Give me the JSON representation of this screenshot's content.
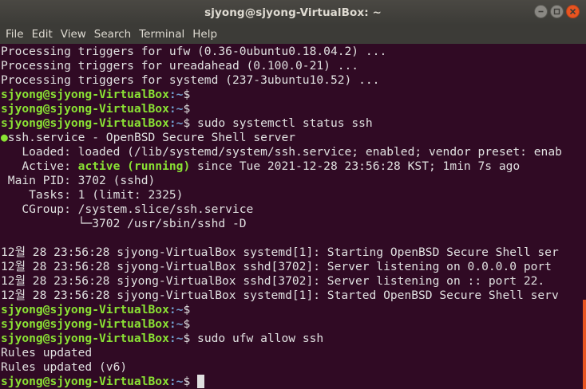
{
  "window": {
    "title": "sjyong@sjyong-VirtualBox: ~"
  },
  "menu": {
    "items": [
      "File",
      "Edit",
      "View",
      "Search",
      "Terminal",
      "Help"
    ]
  },
  "terminal": {
    "prompt_user": "sjyong@sjyong-VirtualBox",
    "prompt_path": ":~",
    "prompt_suffix": "$",
    "l1": "Processing triggers for ufw (0.36-0ubuntu0.18.04.2) ...",
    "l2": "Processing triggers for ureadahead (0.100.0-21) ...",
    "l3": "Processing triggers for systemd (237-3ubuntu10.52) ...",
    "cmd_status": " sudo systemctl status ssh",
    "status_dot": "●",
    "service_line": "ssh.service - OpenBSD Secure Shell server",
    "loaded_line": "   Loaded: loaded (/lib/systemd/system/ssh.service; enabled; vendor preset: enab",
    "active_label": "   Active: ",
    "active_value": "active (running)",
    "active_rest": " since Tue 2021-12-28 23:56:28 KST; 1min 7s ago",
    "mainpid_line": " Main PID: 3702 (sshd)",
    "tasks_line": "    Tasks: 1 (limit: 2325)",
    "cgroup_line": "   CGroup: /system.slice/ssh.service",
    "cgroup_child": "           └─3702 /usr/sbin/sshd -D",
    "log1": "12월 28 23:56:28 sjyong-VirtualBox systemd[1]: Starting OpenBSD Secure Shell ser",
    "log2": "12월 28 23:56:28 sjyong-VirtualBox sshd[3702]: Server listening on 0.0.0.0 port",
    "log3": "12월 28 23:56:28 sjyong-VirtualBox sshd[3702]: Server listening on :: port 22.",
    "log4": "12월 28 23:56:28 sjyong-VirtualBox systemd[1]: Started OpenBSD Secure Shell serv",
    "cmd_ufw": " sudo ufw allow ssh",
    "rules1": "Rules updated",
    "rules2": "Rules updated (v6)"
  },
  "colors": {
    "background": "#300a24",
    "prompt_user": "#8ae234",
    "prompt_path": "#729fcf",
    "accent": "#e95420"
  }
}
